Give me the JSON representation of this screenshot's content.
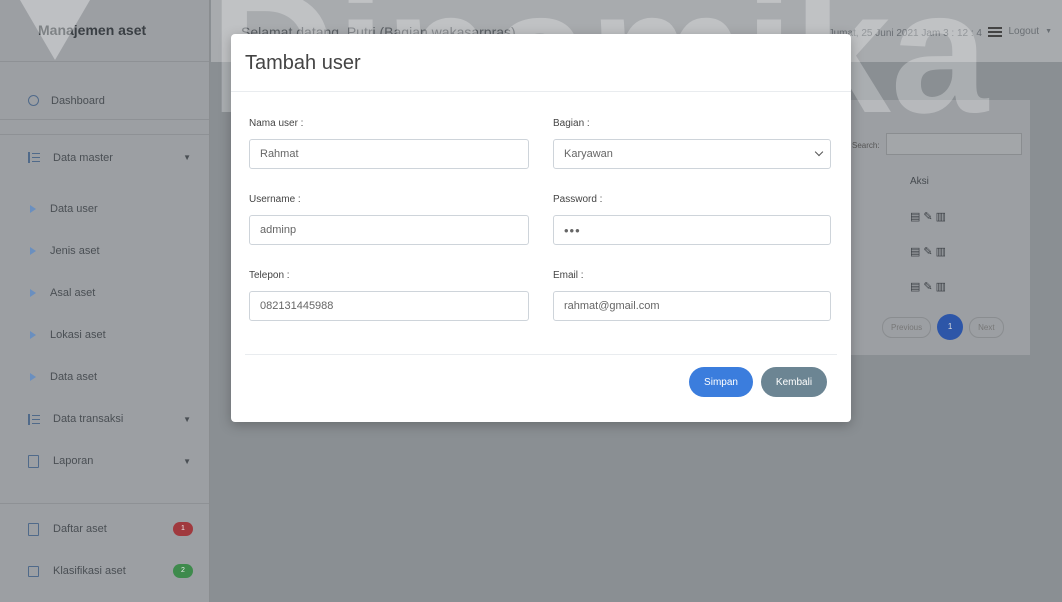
{
  "sidebar": {
    "brand": "Manajemen aset",
    "dashboard": "Dashboard",
    "items": [
      {
        "label": "Data master",
        "has_caret": true
      },
      {
        "label": "Data user"
      },
      {
        "label": "Jenis aset"
      },
      {
        "label": "Asal aset"
      },
      {
        "label": "Lokasi aset"
      },
      {
        "label": "Data aset"
      },
      {
        "label": "Data transaksi",
        "has_caret": true
      },
      {
        "label": "Laporan",
        "has_caret": true
      },
      {
        "label": "Daftar aset",
        "badge": "1",
        "badge_color": "#a0393e"
      },
      {
        "label": "Klasifikasi aset",
        "badge": "2",
        "badge_color": "#3e8a4c"
      }
    ]
  },
  "topbar": {
    "welcome": "Selamat datang, Putri (Bagian wakasarpras)",
    "date": "Jumat, 25 Juni 2021 Jam 3 : 12 : 4",
    "logout": "Logout"
  },
  "panel": {
    "search_label": "Search:",
    "aksi_header": "Aksi",
    "pager": {
      "previous": "Previous",
      "page": "1",
      "next": "Next"
    }
  },
  "watermark": {
    "text": "Dinamika"
  },
  "modal": {
    "title": "Tambah user",
    "fields": {
      "nama_user": {
        "label": "Nama user :",
        "value": "Rahmat"
      },
      "bagian": {
        "label": "Bagian :",
        "value": "Karyawan"
      },
      "username": {
        "label": "Username :",
        "value": "adminp"
      },
      "password": {
        "label": "Password :",
        "value": "•••"
      },
      "telepon": {
        "label": "Telepon :",
        "value": "082131445988"
      },
      "email": {
        "label": "Email :",
        "value": "rahmat@gmail.com"
      }
    },
    "save_label": "Simpan",
    "back_label": "Kembali"
  },
  "colors": {
    "primary": "#3b7ddd",
    "secondary": "#6c8593"
  }
}
